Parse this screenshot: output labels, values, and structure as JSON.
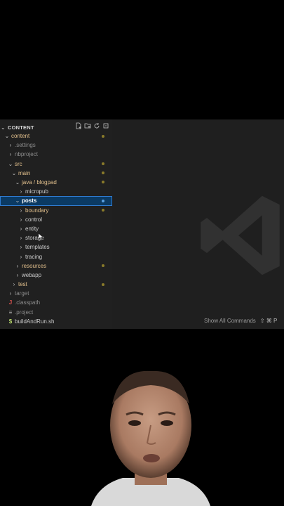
{
  "explorer": {
    "title": "CONTENT",
    "actions": [
      "new-file-icon",
      "new-folder-icon",
      "refresh-icon",
      "collapse-all-icon"
    ]
  },
  "tree": [
    {
      "label": "content",
      "icon": "chevron-down-icon",
      "color": "#e2c08d",
      "dot": true
    },
    {
      "label": ".settings",
      "icon": "chevron-right-icon",
      "color": "#8c8c8c"
    },
    {
      "label": "nbproject",
      "icon": "chevron-right-icon",
      "color": "#8c8c8c"
    },
    {
      "label": "src",
      "icon": "chevron-down-icon",
      "color": "#e2c08d",
      "dot": true
    },
    {
      "label": "main",
      "icon": "chevron-down-icon",
      "color": "#e2c08d",
      "dot": true
    },
    {
      "label": "java / blogpad",
      "icon": "chevron-down-icon",
      "color": "#e2c08d",
      "dot": true
    },
    {
      "label": "micropub",
      "icon": "chevron-right-icon",
      "color": "#cccccc"
    },
    {
      "label": "posts",
      "icon": "chevron-down-icon",
      "color": "#ffffff",
      "dot": true
    },
    {
      "label": "boundary",
      "icon": "chevron-right-icon",
      "color": "#e2c08d",
      "dot": true
    },
    {
      "label": "control",
      "icon": "chevron-right-icon",
      "color": "#cccccc"
    },
    {
      "label": "entity",
      "icon": "chevron-right-icon",
      "color": "#cccccc"
    },
    {
      "label": "storage",
      "icon": "chevron-right-icon",
      "color": "#cccccc"
    },
    {
      "label": "templates",
      "icon": "chevron-right-icon",
      "color": "#cccccc"
    },
    {
      "label": "tracing",
      "icon": "chevron-right-icon",
      "color": "#cccccc"
    },
    {
      "label": "resources",
      "icon": "chevron-right-icon",
      "color": "#e2c08d",
      "dot": true
    },
    {
      "label": "webapp",
      "icon": "chevron-right-icon",
      "color": "#cccccc"
    },
    {
      "label": "test",
      "icon": "chevron-right-icon",
      "color": "#e2c08d",
      "dot": true
    },
    {
      "label": "target",
      "icon": "chevron-right-icon",
      "color": "#8c8c8c"
    },
    {
      "label": ".classpath",
      "icon": "java-file-icon",
      "color": "#8c8c8c"
    },
    {
      "label": ".project",
      "icon": "list-file-icon",
      "color": "#8c8c8c"
    },
    {
      "label": "buildAndRun.sh",
      "icon": "shell-file-icon",
      "color": "#cccccc"
    }
  ],
  "editor": {
    "show_all_commands": "Show All Commands",
    "shortcut": "⇧ ⌘ P"
  }
}
